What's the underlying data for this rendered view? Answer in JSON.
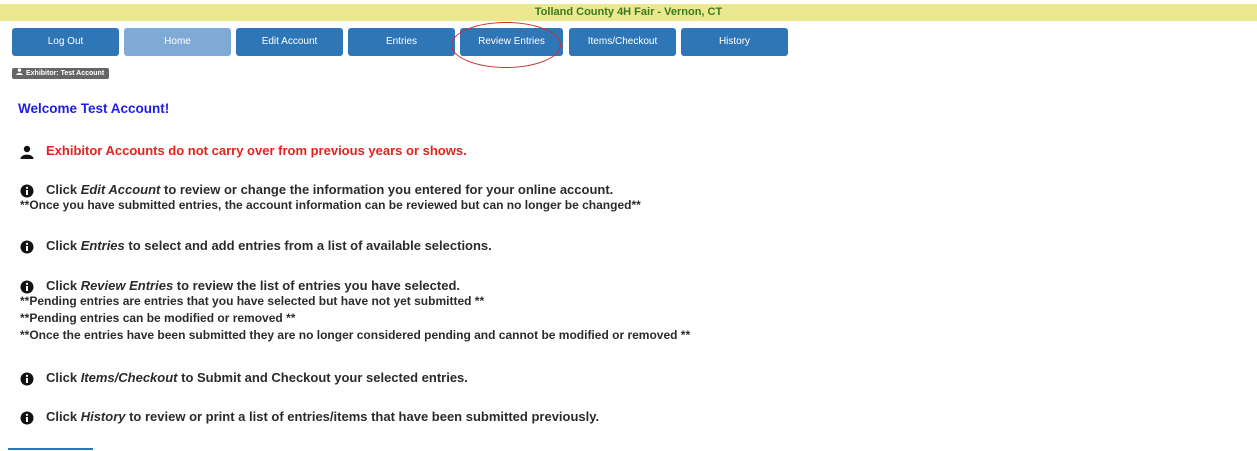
{
  "banner": {
    "title": "Tolland County 4H Fair - Vernon, CT"
  },
  "nav": {
    "logout": "Log Out",
    "home": "Home",
    "edit_account": "Edit Account",
    "entries": "Entries",
    "review_entries": "Review Entries",
    "items_checkout": "Items/Checkout",
    "history": "History"
  },
  "badge": {
    "label": "Exhibitor: Test Account"
  },
  "welcome": "Welcome Test Account!",
  "notice": "Exhibitor Accounts do not carry over from previous years or shows.",
  "items": [
    {
      "pre": "Click ",
      "link": "Edit Account",
      "post": " to review or change the information you entered for your online account."
    },
    {
      "pre": "Click ",
      "link": "Entries",
      "post": " to select and add entries from a list of available selections."
    },
    {
      "pre": "Click ",
      "link": "Review Entries",
      "post": " to review the list of entries you have selected."
    },
    {
      "pre": "Click ",
      "link": "Items/Checkout",
      "post": " to Submit and Checkout your selected entries."
    },
    {
      "pre": "Click ",
      "link": "History",
      "post": " to review or print a list of entries/items that have been submitted previously."
    }
  ],
  "notes": {
    "edit_account": "**Once you have submitted entries, the account information can be reviewed but can no longer be changed**",
    "review_1": "**Pending entries are entries that you have selected but have not yet submitted **",
    "review_2": "**Pending entries can be modified or removed **",
    "review_3": "**Once the entries have been submitted they are no longer considered pending and cannot be modified or removed **"
  },
  "colors": {
    "banner_bg": "#ece892",
    "banner_text": "#3a7a1e",
    "nav_button": "#2f76b7",
    "nav_active": "#7faad6",
    "welcome": "#1e1ee6",
    "notice": "#e8201e",
    "highlight_ring": "#c9302c"
  },
  "icons": {
    "user": "user-icon",
    "info": "info-circle-icon"
  }
}
